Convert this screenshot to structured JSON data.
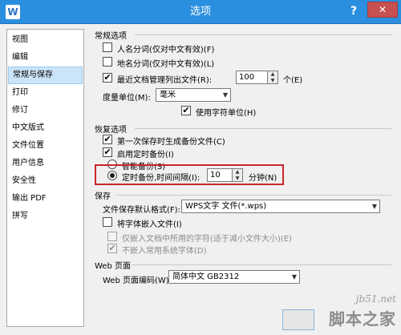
{
  "window": {
    "title": "选项",
    "app_icon": "W",
    "help": "?",
    "close": "✕"
  },
  "sidebar": {
    "items": [
      "视图",
      "编辑",
      "常规与保存",
      "打印",
      "修订",
      "中文版式",
      "文件位置",
      "用户信息",
      "安全性",
      "输出 PDF",
      "拼写"
    ],
    "selected_index": 2
  },
  "general": {
    "title": "常规选项",
    "name_split": {
      "label": "人名分词(仅对中文有效)(F)",
      "checked": false
    },
    "place_split": {
      "label": "地名分词(仅对中文有效)(L)",
      "checked": false
    },
    "recent_docs": {
      "label": "最近文档管理列出文件(R):",
      "checked": true,
      "value": "100",
      "unit": "个(E)"
    },
    "unit_measure": {
      "label": "度量单位(M):",
      "value": "毫米"
    },
    "char_unit": {
      "label": "使用字符单位(H)",
      "checked": true
    }
  },
  "recovery": {
    "title": "恢复选项",
    "first_backup": {
      "label": "第一次保存时生成备份文件(C)",
      "checked": true
    },
    "timed_backup": {
      "label": "启用定时备份(I)",
      "checked": true
    },
    "smart_backup": {
      "label": "智能备份(S)",
      "selected": false
    },
    "interval_backup": {
      "label": "定时备份,时间间隔(I):",
      "selected": true,
      "value": "10",
      "unit": "分钟(N)"
    }
  },
  "save": {
    "title": "保存",
    "default_format": {
      "label": "文件保存默认格式(F):",
      "value": "WPS文字 文件(*.wps)"
    },
    "embed_fonts": {
      "label": "将字体嵌入文件(I)",
      "checked": false
    },
    "embed_used_only": {
      "label": "仅嵌入文档中所用的字符(适于减小文件大小)(E)",
      "checked": false
    },
    "no_common_fonts": {
      "label": "不嵌入常用系统字体(D)",
      "checked": true
    }
  },
  "web": {
    "title": "Web 页面",
    "encoding": {
      "label": "Web 页面编码(W):",
      "value": "简体中文 GB2312"
    }
  },
  "icons": {
    "check": "✔",
    "spin_up": "▲",
    "spin_down": "▼",
    "dropdown": "▼"
  },
  "watermark": {
    "site": "jb51.net",
    "name": "脚本之家"
  },
  "colors": {
    "titlebar": "#2b8fe0",
    "close": "#c75050",
    "highlight": "#c8262a",
    "selected": "#cce4f7"
  }
}
